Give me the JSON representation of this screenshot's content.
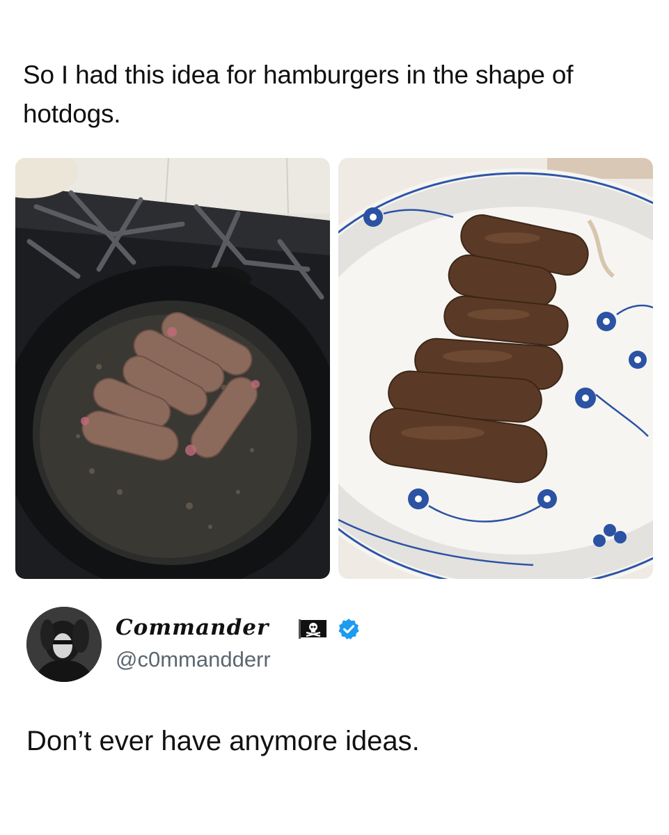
{
  "post": {
    "text": "So I had this idea for hamburgers in the shape of hotdogs."
  },
  "images": [
    {
      "icon": "photo-skillet-raw-patties"
    },
    {
      "icon": "photo-plate-cooked-patties"
    }
  ],
  "reply": {
    "display_name": "Commander",
    "name_emoji_icon": "pirate-flag-icon",
    "badge_icon": "verified-badge-icon",
    "handle": "@c0mmandderr",
    "text": "Don’t ever have anymore ideas."
  },
  "colors": {
    "verified": "#1d9bf0",
    "handle": "#5b6670",
    "text": "#111111"
  }
}
